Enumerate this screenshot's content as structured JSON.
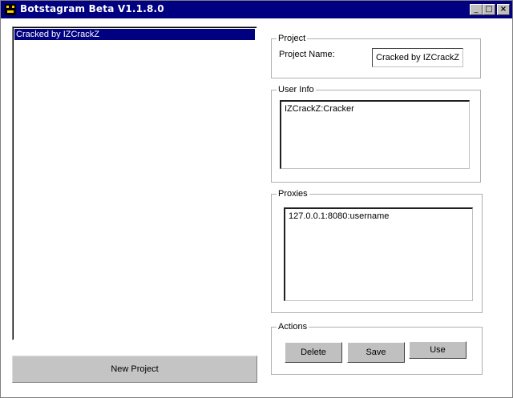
{
  "window": {
    "title": "Botstagram Beta V1.1.8.0"
  },
  "titlebar_buttons": {
    "minimize": "_",
    "maximize": "□",
    "close": "×"
  },
  "projects_list": {
    "items": [
      "Cracked by IZCrackZ"
    ],
    "selected_index": 0
  },
  "new_project_button": "New Project",
  "project_group": {
    "legend": "Project",
    "name_label": "Project Name:",
    "name_value": "Cracked by IZCrackZ"
  },
  "user_info_group": {
    "legend": "User Info",
    "value": "IZCrackZ:Cracker"
  },
  "proxies_group": {
    "legend": "Proxies",
    "value": "127.0.0.1:8080:username"
  },
  "actions_group": {
    "legend": "Actions",
    "delete": "Delete",
    "save": "Save",
    "use": "Use"
  },
  "colors": {
    "titlebar": "#000080",
    "selection": "#000080",
    "button_face": "#c0c0c0"
  },
  "icons": {
    "app": "app-icon"
  }
}
